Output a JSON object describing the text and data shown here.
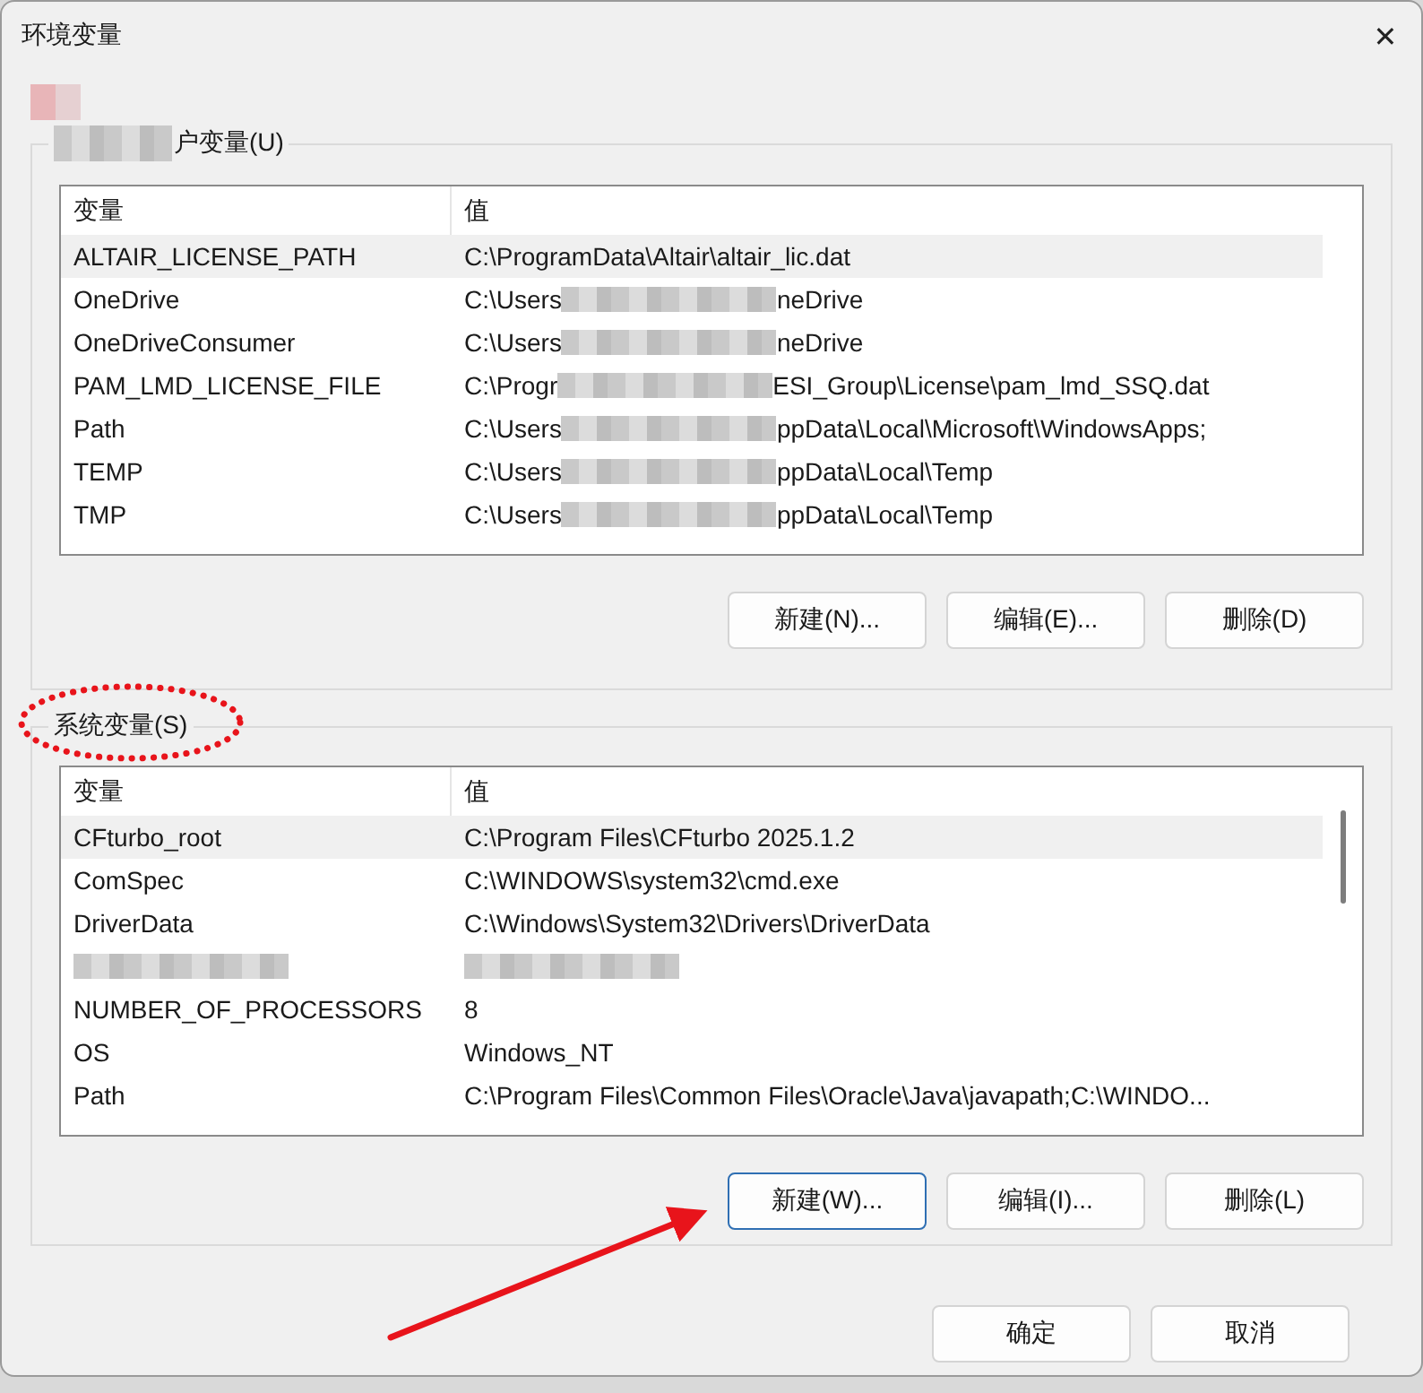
{
  "window": {
    "title": "环境变量",
    "close": "✕"
  },
  "user_group": {
    "label": [
      {
        "kind": "blur"
      },
      {
        "kind": "text",
        "text": "户变量(U)"
      }
    ],
    "columns": [
      "变量",
      "值"
    ],
    "rows": [
      {
        "selected": true,
        "name": [
          {
            "kind": "text",
            "text": "ALTAIR_LICENSE_PATH"
          }
        ],
        "value": [
          {
            "kind": "text",
            "text": "C:\\ProgramData\\Altair\\altair_lic.dat"
          }
        ]
      },
      {
        "selected": false,
        "name": [
          {
            "kind": "text",
            "text": "OneDrive"
          }
        ],
        "value": [
          {
            "kind": "text",
            "text": "C:\\Users"
          },
          {
            "kind": "blur"
          },
          {
            "kind": "text",
            "text": "neDrive"
          }
        ]
      },
      {
        "selected": false,
        "name": [
          {
            "kind": "text",
            "text": "OneDriveConsumer"
          }
        ],
        "value": [
          {
            "kind": "text",
            "text": "C:\\Users"
          },
          {
            "kind": "blur"
          },
          {
            "kind": "text",
            "text": "neDrive"
          }
        ]
      },
      {
        "selected": false,
        "name": [
          {
            "kind": "text",
            "text": "PAM_LMD_LICENSE_FILE"
          }
        ],
        "value": [
          {
            "kind": "text",
            "text": "C:\\Progr"
          },
          {
            "kind": "blur"
          },
          {
            "kind": "text",
            "text": "ESI_Group\\License\\pam_lmd_SSQ.dat"
          }
        ]
      },
      {
        "selected": false,
        "name": [
          {
            "kind": "text",
            "text": "Path"
          }
        ],
        "value": [
          {
            "kind": "text",
            "text": "C:\\Users"
          },
          {
            "kind": "blur"
          },
          {
            "kind": "text",
            "text": "ppData\\Local\\Microsoft\\WindowsApps;"
          }
        ]
      },
      {
        "selected": false,
        "name": [
          {
            "kind": "text",
            "text": "TEMP"
          }
        ],
        "value": [
          {
            "kind": "text",
            "text": "C:\\Users"
          },
          {
            "kind": "blur"
          },
          {
            "kind": "text",
            "text": "ppData\\Local\\Temp"
          }
        ]
      },
      {
        "selected": false,
        "name": [
          {
            "kind": "text",
            "text": "TMP"
          }
        ],
        "value": [
          {
            "kind": "text",
            "text": "C:\\Users"
          },
          {
            "kind": "blur"
          },
          {
            "kind": "text",
            "text": "ppData\\Local\\Temp"
          }
        ]
      }
    ],
    "buttons": [
      {
        "label": "新建(N)...",
        "focused": false
      },
      {
        "label": "编辑(E)...",
        "focused": false
      },
      {
        "label": "删除(D)",
        "focused": false
      }
    ]
  },
  "system_group": {
    "label": [
      {
        "kind": "text",
        "text": "系统变量(S)"
      }
    ],
    "columns": [
      "变量",
      "值"
    ],
    "rows": [
      {
        "selected": true,
        "name": [
          {
            "kind": "text",
            "text": "CFturbo_root"
          }
        ],
        "value": [
          {
            "kind": "text",
            "text": "C:\\Program Files\\CFturbo 2025.1.2"
          }
        ]
      },
      {
        "selected": false,
        "name": [
          {
            "kind": "text",
            "text": "ComSpec"
          }
        ],
        "value": [
          {
            "kind": "text",
            "text": "C:\\WINDOWS\\system32\\cmd.exe"
          }
        ]
      },
      {
        "selected": false,
        "name": [
          {
            "kind": "text",
            "text": "DriverData"
          }
        ],
        "value": [
          {
            "kind": "text",
            "text": "C:\\Windows\\System32\\Drivers\\DriverData"
          }
        ]
      },
      {
        "selected": false,
        "name": [
          {
            "kind": "blur"
          }
        ],
        "value": [
          {
            "kind": "blur"
          }
        ]
      },
      {
        "selected": false,
        "name": [
          {
            "kind": "text",
            "text": "NUMBER_OF_PROCESSORS"
          }
        ],
        "value": [
          {
            "kind": "text",
            "text": "8"
          }
        ]
      },
      {
        "selected": false,
        "name": [
          {
            "kind": "text",
            "text": "OS"
          }
        ],
        "value": [
          {
            "kind": "text",
            "text": "Windows_NT"
          }
        ]
      },
      {
        "selected": false,
        "name": [
          {
            "kind": "text",
            "text": "Path"
          }
        ],
        "value": [
          {
            "kind": "text",
            "text": "C:\\Program Files\\Common Files\\Oracle\\Java\\javapath;C:\\WINDO..."
          }
        ]
      }
    ],
    "buttons": [
      {
        "label": "新建(W)...",
        "focused": true
      },
      {
        "label": "编辑(I)...",
        "focused": false
      },
      {
        "label": "删除(L)",
        "focused": false
      }
    ]
  },
  "buttons": [
    {
      "label": "确定",
      "focused": false
    },
    {
      "label": "取消",
      "focused": false
    }
  ]
}
